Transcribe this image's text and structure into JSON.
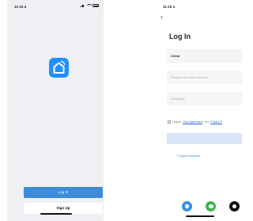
{
  "welcome": {
    "status_time": "11:15 ◂",
    "login_label": "Log In",
    "signup_label": "Sign Up",
    "try_now_label": "Try now"
  },
  "login": {
    "status_time": "11:15 ◂",
    "back_icon": "chevron-left-icon",
    "title": "Log In",
    "country_value": "China",
    "account_placeholder": "Please enter your account",
    "password_placeholder": "Password",
    "agree_prefix": "I Agree",
    "user_agreement": "User Agreement",
    "agree_and": "and",
    "privacy_policy": "Privacy P",
    "forgot_password": "Forgot Password"
  },
  "colors": {
    "accent": "#3d8cd9",
    "logo_bg": "#1e90ff",
    "wechat": "#3cb54a",
    "apple": "#111111"
  }
}
